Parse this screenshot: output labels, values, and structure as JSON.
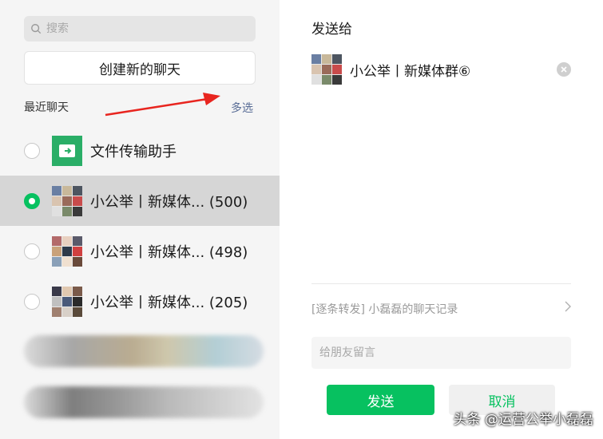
{
  "search": {
    "placeholder": "搜索"
  },
  "create_chat_label": "创建新的聊天",
  "recent_label": "最近聊天",
  "multi_select_label": "多选",
  "chats": [
    {
      "name": "文件传输助手",
      "selected": false
    },
    {
      "name": "小公举丨新媒体...",
      "count": "(500)",
      "selected": true
    },
    {
      "name": "小公举丨新媒体...",
      "count": "(498)",
      "selected": false
    },
    {
      "name": "小公举丨新媒体...",
      "count": "(205)",
      "selected": false
    }
  ],
  "send_to_label": "发送给",
  "target": {
    "name": "小公举丨新媒体群⑥"
  },
  "forward_text": "[逐条转发] 小磊磊的聊天记录",
  "message_placeholder": "给朋友留言",
  "send_label": "发送",
  "cancel_label": "取消",
  "watermark": "头条 @运营公举小磊磊",
  "colors": {
    "accent": "#07c160",
    "link": "#576b95",
    "selected_row": "#d6d6d6"
  }
}
